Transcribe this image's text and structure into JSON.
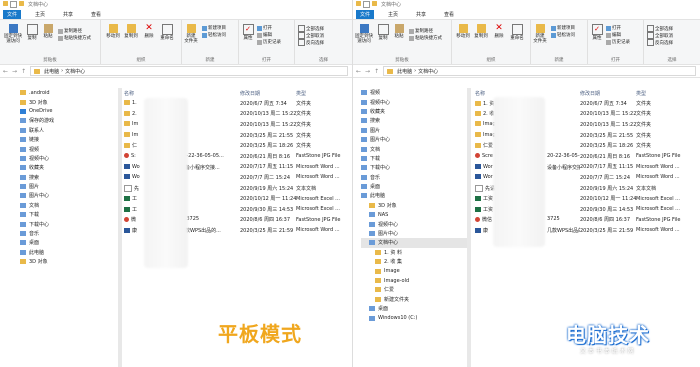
{
  "left": {
    "title": "文档中心",
    "tabs": [
      "文件",
      "主页",
      "共享",
      "查看"
    ],
    "ribbon": {
      "pin": "固定到快\n速访问",
      "copy": "复制",
      "paste": "粘贴",
      "copy_path": "复制路径",
      "paste_shortcut": "粘贴快捷方式",
      "move_to": "移动到",
      "copy_to": "复制到",
      "delete": "删除",
      "rename": "重命名",
      "new_folder": "新建\n文件夹",
      "new_item": "新建项目",
      "easy_access": "轻松访问",
      "properties": "属性",
      "open": "打开",
      "edit": "编辑",
      "history": "历史记录",
      "select_all": "全部选择",
      "select_none": "全部取消",
      "invert": "反向选择",
      "g_clipboard": "剪贴板",
      "g_organize": "组织",
      "g_new": "新建",
      "g_open": "打开",
      "g_select": "选择"
    },
    "breadcrumb": [
      "此电脑",
      "文档中心"
    ],
    "nav": [
      ".android",
      "3D 对象",
      "OneDrive",
      "保存的游戏",
      "联系人",
      "链接",
      "视频",
      "视频中心",
      "收藏夹",
      "搜索",
      "图片",
      "图片中心",
      "文档",
      "下载",
      "下载中心",
      "音乐",
      "桌面",
      "此电脑",
      "3D 对象"
    ],
    "columns": [
      "名称",
      "修改日期",
      "类型"
    ],
    "rows": [
      {
        "icon": "folder",
        "name": "1.",
        "date": "2020/6/7 周五 7:34",
        "type": "文件夹"
      },
      {
        "icon": "folder",
        "name": "2.",
        "date": "2020/10/13 周二 15:22",
        "type": "文件夹"
      },
      {
        "icon": "folder",
        "name": "Im",
        "date": "2020/10/13 周二 15:22",
        "type": "文件夹"
      },
      {
        "icon": "folder",
        "name": "Im",
        "date": "2020/3/25 周三 21:55",
        "type": "文件夹"
      },
      {
        "icon": "folder",
        "name": "仁",
        "date": "2020/3/25 周三 18:26",
        "type": "文件夹"
      },
      {
        "icon": "red",
        "name": "S:",
        "date": "2020/6/21 周日 8:16",
        "type": "FastStone JPG File"
      },
      {
        "icon": "doc",
        "name": "Wo",
        "date": "2020/7/17 周五 11:15",
        "type": "Microsoft Word ..."
      },
      {
        "icon": "doc",
        "name": "Wo",
        "date": "2020/7/7 周二 15:24",
        "type": "Microsoft Word ..."
      },
      {
        "icon": "txt",
        "name": "先",
        "date": "2020/9/19 周六 15:24",
        "type": "文本文档"
      },
      {
        "icon": "xls",
        "name": "工",
        "date": "2020/10/12 周一 11:24",
        "type": "Microsoft Excel ..."
      },
      {
        "icon": "xls",
        "name": "工",
        "date": "2020/9/30 周三 14:53",
        "type": "Microsoft Excel ..."
      },
      {
        "icon": "red",
        "name": "微",
        "date": "2020/8/6 周四 16:37",
        "type": "FastStone JPG File"
      },
      {
        "icon": "doc",
        "name": "康",
        "date": "2020/3/25 周三 21:59",
        "type": "Microsoft Word ..."
      }
    ],
    "frag": {
      "f1": "20-22-36-05-05...",
      "f2": "设备小程序交接...",
      "f3": "163725",
      "f4": "几款WPS出品的..."
    }
  },
  "right": {
    "title": "文档中心",
    "tabs": [
      "文件",
      "主页",
      "共享",
      "查看"
    ],
    "breadcrumb": [
      "此电脑",
      "文档中心"
    ],
    "nav": [
      "视频",
      "视频中心",
      "收藏夹",
      "搜索",
      "图片",
      "图片中心",
      "文档",
      "下载",
      "下载中心",
      "音乐",
      "桌面",
      "此电脑",
      "3D 对象",
      "NAS",
      "视频中心",
      "图片中心",
      "文档中心",
      "1. 资 料",
      "2. 收 集",
      "Image",
      "Image-old",
      "仁爱",
      "新建文件夹",
      "桌面",
      "Windows10 (C:)"
    ],
    "columns": [
      "名称",
      "修改日期",
      "类型"
    ],
    "rows": [
      {
        "icon": "folder",
        "name": "1. 资",
        "date": "2020/6/7 周五 7:34",
        "type": "文件夹"
      },
      {
        "icon": "folder",
        "name": "2. 收",
        "date": "2020/10/13 周二 15:22",
        "type": "文件夹"
      },
      {
        "icon": "folder",
        "name": "Imag",
        "date": "2020/10/13 周二 15:22",
        "type": "文件夹"
      },
      {
        "icon": "folder",
        "name": "Imag",
        "date": "2020/3/25 周三 21:55",
        "type": "文件夹"
      },
      {
        "icon": "folder",
        "name": "仁爱",
        "date": "2020/3/25 周三 18:26",
        "type": "文件夹"
      },
      {
        "icon": "red",
        "name": "Scre",
        "date": "2020/6/21 周日 8:16",
        "type": "FastStone JPG File"
      },
      {
        "icon": "doc",
        "name": "Wor",
        "date": "2020/7/17 周五 11:15",
        "type": "Microsoft Word ..."
      },
      {
        "icon": "doc",
        "name": "Wor",
        "date": "2020/7/7 周二 15:24",
        "type": "Microsoft Word ..."
      },
      {
        "icon": "txt",
        "name": "先请",
        "date": "2020/9/19 周六 15:24",
        "type": "文本文档"
      },
      {
        "icon": "xls",
        "name": "工资",
        "date": "2020/10/12 周一 11:24",
        "type": "Microsoft Excel ..."
      },
      {
        "icon": "xls",
        "name": "工资",
        "date": "2020/9/30 周三 14:53",
        "type": "Microsoft Excel ..."
      },
      {
        "icon": "red",
        "name": "微信",
        "date": "2020/8/6 周四 16:37",
        "type": "FastStone JPG File"
      },
      {
        "icon": "doc",
        "name": "康",
        "date": "2020/3/25 周三 21:59",
        "type": "Microsoft Word ..."
      }
    ],
    "frag": {
      "f1": "20-22-36-05-05...",
      "f2": "设备小程序交接...",
      "f3": "3725",
      "f4": "几款WPS出品的..."
    }
  },
  "overlay": {
    "tablet_mode": "平板模式",
    "watermark": "电脑技术",
    "watermark_sub": "文 本 书 本 纸 术 网"
  },
  "colors": {
    "accent": "#1979ca",
    "folder": "#e9b949",
    "tablet_text": "#f0a71e"
  }
}
